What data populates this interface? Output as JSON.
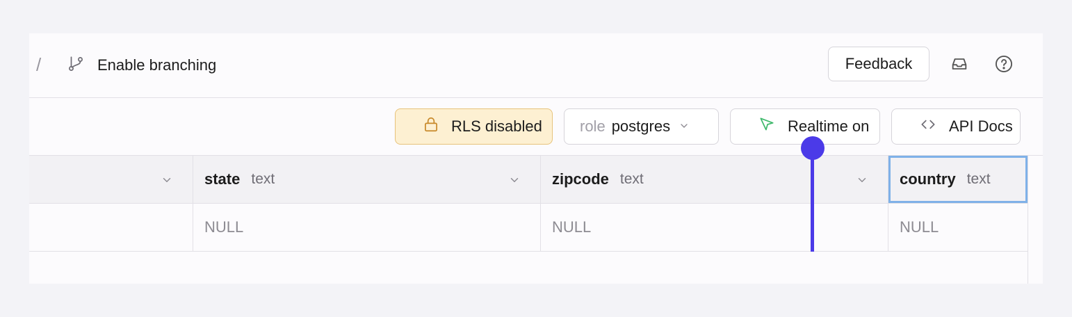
{
  "header": {
    "separator": "/",
    "branch_label": "Enable branching",
    "feedback_label": "Feedback"
  },
  "toolbar": {
    "rls_label": "RLS disabled",
    "role_prefix": "role",
    "role_value": "postgres",
    "realtime_label": "Realtime on",
    "api_docs_label": "API Docs"
  },
  "table": {
    "columns": [
      {
        "name": "",
        "type": ""
      },
      {
        "name": "state",
        "type": "text"
      },
      {
        "name": "zipcode",
        "type": "text"
      },
      {
        "name": "country",
        "type": "text"
      }
    ],
    "row": [
      "",
      "NULL",
      "NULL",
      "NULL"
    ]
  },
  "colors": {
    "accent_marker": "#4b3ae8",
    "rls_bg": "#fdf0d2",
    "selected_outline": "#7fb1e8"
  },
  "icons": [
    "git-branch-icon",
    "inbox-icon",
    "help-icon",
    "lock-icon",
    "chevron-down-icon",
    "cursor-pointer-icon",
    "code-icon"
  ]
}
